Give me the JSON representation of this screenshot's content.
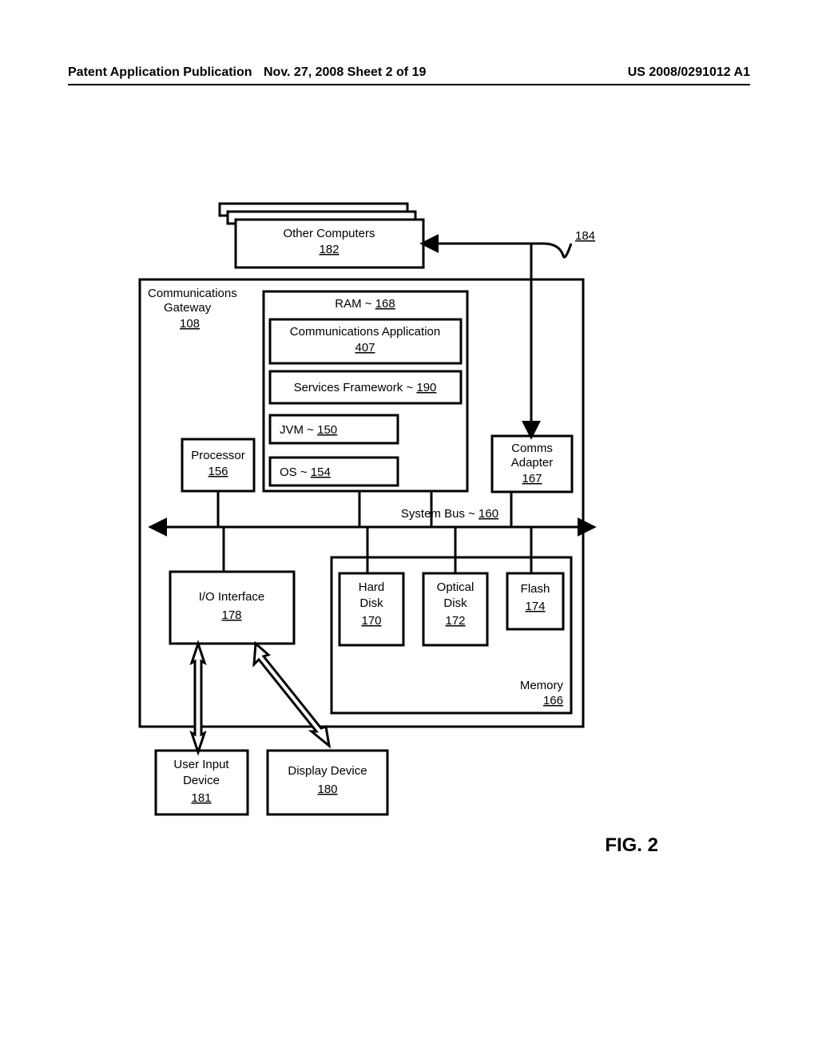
{
  "header": {
    "left": "Patent Application Publication",
    "mid": "Nov. 27, 2008   Sheet 2 of 19",
    "right": "US 2008/0291012 A1"
  },
  "labels": {
    "other_comp": "Other Computers",
    "other_comp_ref": "182",
    "net_ref": "184",
    "gateway": "Communications",
    "gateway2": "Gateway",
    "gateway_ref": "108",
    "ram": "RAM ~ ",
    "ram_ref": "168",
    "comm_app": "Communications Application",
    "comm_app_ref": "407",
    "svc_fw": "Services Framework ~ ",
    "svc_fw_ref": "190",
    "jvm": "JVM ~ ",
    "jvm_ref": "150",
    "os": "OS ~ ",
    "os_ref": "154",
    "processor": "Processor",
    "processor_ref": "156",
    "adapter": "Comms",
    "adapter2": "Adapter",
    "adapter_ref": "167",
    "bus": "System Bus ~ ",
    "bus_ref": "160",
    "io": "I/O Interface",
    "io_ref": "178",
    "hd": "Hard",
    "hd2": "Disk",
    "hd_ref": "170",
    "od": "Optical",
    "od2": "Disk",
    "od_ref": "172",
    "flash": "Flash",
    "flash_ref": "174",
    "memory": "Memory",
    "memory_ref": "166",
    "uid": "User Input",
    "uid2": "Device",
    "uid_ref": "181",
    "disp": "Display Device",
    "disp_ref": "180"
  },
  "figure": "FIG. 2"
}
